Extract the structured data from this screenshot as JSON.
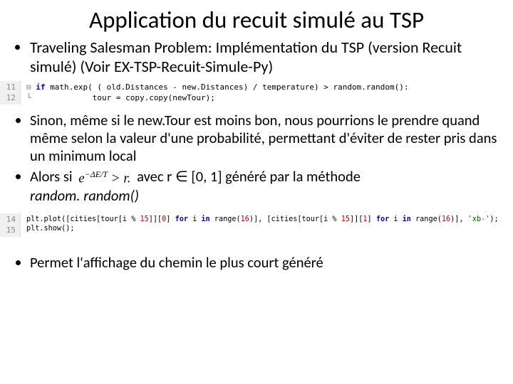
{
  "title": "Application du recuit simulé au TSP",
  "bullets1": {
    "item1": "Traveling Salesman Problem: Implémentation du TSP (version Recuit simulé) (Voir EX-TSP-Recuit-Simule-Py)"
  },
  "code1": {
    "ln1": "11",
    "ln2": "12",
    "line1_kw_if": "if",
    "line1_rest_a": " math.exp( ( old.Distances - new.Distances) / temperature) > random.random():",
    "line2": "            tour = copy.copy(newTour);"
  },
  "bullets2": {
    "item1": "Sinon, même si le new.Tour est moins bon, nous pourrions le prendre quand même selon la valeur d'une probabilité, permettant d'éviter de rester pris dans un minimum local",
    "item2_a": "Alors si ",
    "item2_formula": "e",
    "item2_exp": "−ΔE/T",
    "item2_gt": " > r.",
    "item2_b": "   avec r ",
    "item2_in": "∈",
    "item2_c": " [0, 1]  généré par la méthode",
    "item2_d": "random. random()"
  },
  "code2": {
    "ln1": "14",
    "ln2": "15",
    "line1_a": "plt.plot([cities[tour[i % ",
    "line1_n1": "15",
    "line1_b": "]][",
    "line1_n0a": "0",
    "line1_c": "] ",
    "line1_for1": "for",
    "line1_d": " i ",
    "line1_in1": "in",
    "line1_e": " range(",
    "line1_n16a": "16",
    "line1_f": ")], [cities[tour[i % ",
    "line1_n15b": "15",
    "line1_g": "]][",
    "line1_n1b": "1",
    "line1_h": "] ",
    "line1_for2": "for",
    "line1_i": " i ",
    "line1_in2": "in",
    "line1_j": " range(",
    "line1_n16b": "16",
    "line1_k": ")], ",
    "line1_str": "'xb-'",
    "line1_l": ");",
    "line2": "plt.show();"
  },
  "bullets3": {
    "item1": "Permet l'affichage du chemin le plus court généré"
  }
}
